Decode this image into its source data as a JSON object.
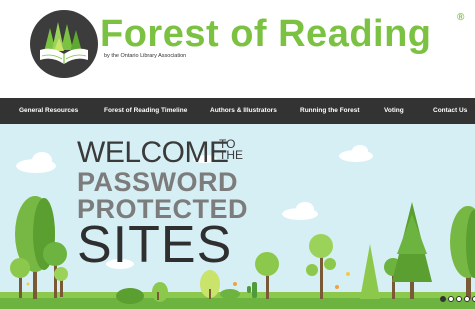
{
  "header": {
    "brand_title": "Forest of Reading",
    "brand_reg": "®",
    "brand_subtitle": "by the Ontario Library Association"
  },
  "nav": {
    "items": [
      "General Resources",
      "Forest of Reading Timeline",
      "Authors & Illustrators",
      "Running the Forest",
      "Voting",
      "Contact Us"
    ]
  },
  "hero": {
    "welcome": "WELCOME",
    "to_the": "TO THE",
    "password": "PASSWORD",
    "protected": "PROTECTED",
    "sites": "SITES"
  },
  "slider": {
    "dot_count": 5,
    "active_index": 0
  },
  "colors": {
    "brand_green": "#7cc242",
    "nav_background": "#333333",
    "sky": "#d6eff4"
  }
}
